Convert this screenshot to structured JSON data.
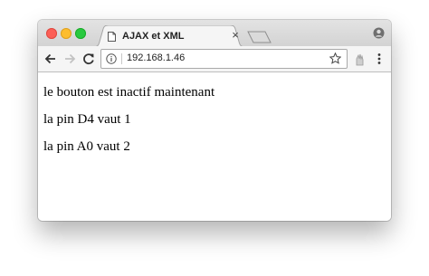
{
  "browser": {
    "tab": {
      "title": "AJAX et XML",
      "close_glyph": "×"
    },
    "address_bar": {
      "url": "192.168.1.46"
    },
    "icons": [
      "close-light",
      "minimize-light",
      "zoom-light",
      "page-icon",
      "close-icon",
      "new-tab-icon",
      "profile-icon",
      "back-arrow-icon",
      "forward-arrow-icon",
      "reload-icon",
      "info-icon",
      "star-icon",
      "extension-icon",
      "menu-icon"
    ]
  },
  "page": {
    "lines": [
      "le bouton est inactif maintenant",
      "la pin D4 vaut 1",
      "la pin A0 vaut 2"
    ]
  }
}
